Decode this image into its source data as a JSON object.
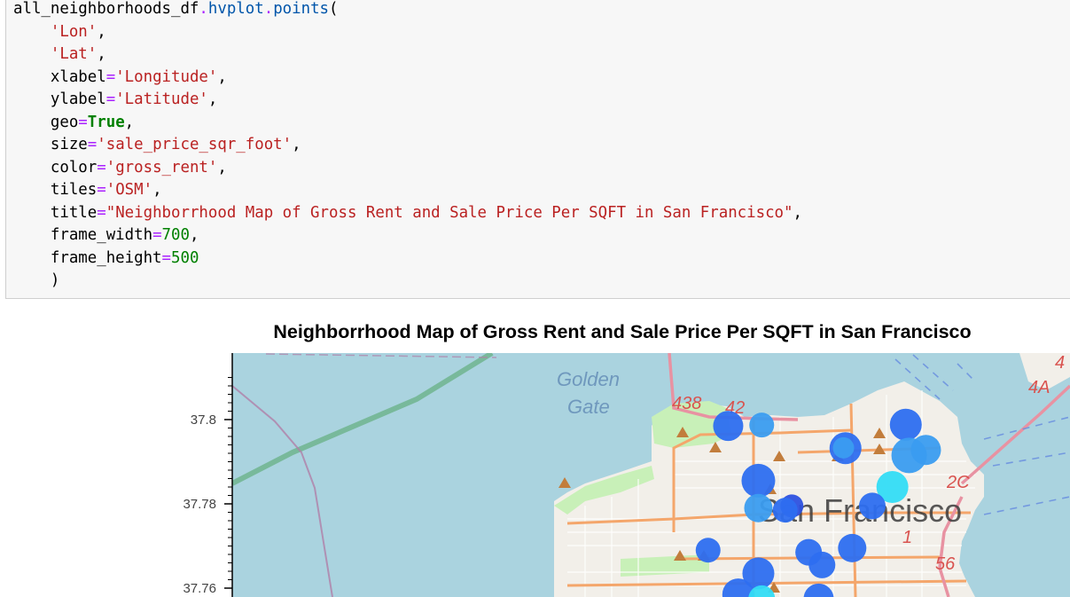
{
  "code_cell": {
    "lines": [
      [
        {
          "t": "all_neighborhoods_df",
          "c": "var"
        },
        {
          "t": ".",
          "c": "op"
        },
        {
          "t": "hvplot",
          "c": "attr"
        },
        {
          "t": ".",
          "c": "op"
        },
        {
          "t": "points",
          "c": "attr"
        },
        {
          "t": "(",
          "c": "var"
        }
      ],
      [
        {
          "t": "    ",
          "c": "var"
        },
        {
          "t": "'Lon'",
          "c": "str"
        },
        {
          "t": ",",
          "c": "var"
        }
      ],
      [
        {
          "t": "    ",
          "c": "var"
        },
        {
          "t": "'Lat'",
          "c": "str"
        },
        {
          "t": ",",
          "c": "var"
        }
      ],
      [
        {
          "t": "    xlabel",
          "c": "var"
        },
        {
          "t": "=",
          "c": "op"
        },
        {
          "t": "'Longitude'",
          "c": "str"
        },
        {
          "t": ",",
          "c": "var"
        }
      ],
      [
        {
          "t": "    ylabel",
          "c": "var"
        },
        {
          "t": "=",
          "c": "op"
        },
        {
          "t": "'Latitude'",
          "c": "str"
        },
        {
          "t": ",",
          "c": "var"
        }
      ],
      [
        {
          "t": "    geo",
          "c": "var"
        },
        {
          "t": "=",
          "c": "op"
        },
        {
          "t": "True",
          "c": "kw"
        },
        {
          "t": ",",
          "c": "var"
        }
      ],
      [
        {
          "t": "    size",
          "c": "var"
        },
        {
          "t": "=",
          "c": "op"
        },
        {
          "t": "'sale_price_sqr_foot'",
          "c": "str"
        },
        {
          "t": ",",
          "c": "var"
        }
      ],
      [
        {
          "t": "    color",
          "c": "var"
        },
        {
          "t": "=",
          "c": "op"
        },
        {
          "t": "'gross_rent'",
          "c": "str"
        },
        {
          "t": ",",
          "c": "var"
        }
      ],
      [
        {
          "t": "    tiles",
          "c": "var"
        },
        {
          "t": "=",
          "c": "op"
        },
        {
          "t": "'OSM'",
          "c": "str"
        },
        {
          "t": ",",
          "c": "var"
        }
      ],
      [
        {
          "t": "    title",
          "c": "var"
        },
        {
          "t": "=",
          "c": "op"
        },
        {
          "t": "\"Neighborrhood Map of Gross Rent and Sale Price Per SQFT in San Francisco\"",
          "c": "str"
        },
        {
          "t": ",",
          "c": "var"
        }
      ],
      [
        {
          "t": "    frame_width",
          "c": "var"
        },
        {
          "t": "=",
          "c": "op"
        },
        {
          "t": "700",
          "c": "num"
        },
        {
          "t": ",",
          "c": "var"
        }
      ],
      [
        {
          "t": "    frame_height",
          "c": "var"
        },
        {
          "t": "=",
          "c": "op"
        },
        {
          "t": "500",
          "c": "num"
        }
      ],
      [
        {
          "t": "    )",
          "c": "var"
        }
      ]
    ]
  },
  "plot": {
    "title": "Neighborrhood Map of Gross Rent and Sale Price Per SQFT in San Francisco",
    "y_ticks": [
      "37.8",
      "37.78",
      "37.76"
    ],
    "map_labels": {
      "golden": "Golden",
      "gate": "Gate",
      "city": "San Francisco",
      "route_438": "438",
      "route_42": "42",
      "route_4": "4",
      "route_4a": "4A",
      "route_2c": "2C",
      "route_56": "56",
      "route_1": "1"
    }
  },
  "colors": {
    "water": "#aad3df",
    "land": "#f2efe9",
    "park": "#c8f0b8",
    "major_road": "#f4a66b",
    "highway": "#e892a2",
    "point_blue": "#2d6ef0",
    "point_mid": "#3a9cf0",
    "point_cyan": "#33dcf5"
  },
  "chart_data": {
    "type": "scatter",
    "title": "Neighborrhood Map of Gross Rent and Sale Price Per SQFT in San Francisco",
    "ylabel": "",
    "xlabel": "",
    "y_ticks": [
      37.8,
      37.78,
      37.76
    ],
    "tiles": "OSM",
    "points": [
      {
        "lon": -122.446,
        "lat": 37.7985,
        "size": 34,
        "color": "#2d6ef0"
      },
      {
        "lon": -122.441,
        "lat": 37.7987,
        "size": 28,
        "color": "#3a9cf0"
      },
      {
        "lon": -122.4285,
        "lat": 37.7932,
        "size": 36,
        "color": "#2d6ef0"
      },
      {
        "lon": -122.4288,
        "lat": 37.7933,
        "size": 24,
        "color": "#3a9cf0"
      },
      {
        "lon": -122.4195,
        "lat": 37.7988,
        "size": 36,
        "color": "#2d6ef0"
      },
      {
        "lon": -122.419,
        "lat": 37.7915,
        "size": 40,
        "color": "#3a9cf0"
      },
      {
        "lon": -122.4165,
        "lat": 37.7928,
        "size": 34,
        "color": "#3a9cf0"
      },
      {
        "lon": -122.4215,
        "lat": 37.784,
        "size": 36,
        "color": "#33dcf5"
      },
      {
        "lon": -122.4415,
        "lat": 37.7855,
        "size": 38,
        "color": "#2d6ef0"
      },
      {
        "lon": -122.4415,
        "lat": 37.779,
        "size": 32,
        "color": "#3a9cf0"
      },
      {
        "lon": -122.4365,
        "lat": 37.7795,
        "size": 26,
        "color": "#2d51e0"
      },
      {
        "lon": -122.4375,
        "lat": 37.7785,
        "size": 28,
        "color": "#2d6ef0"
      },
      {
        "lon": -122.4245,
        "lat": 37.7795,
        "size": 30,
        "color": "#2d6ef0"
      },
      {
        "lon": -122.449,
        "lat": 37.769,
        "size": 28,
        "color": "#2d6ef0"
      },
      {
        "lon": -122.434,
        "lat": 37.7685,
        "size": 30,
        "color": "#2d6ef0"
      },
      {
        "lon": -122.432,
        "lat": 37.7655,
        "size": 30,
        "color": "#2d6ef0"
      },
      {
        "lon": -122.4275,
        "lat": 37.7695,
        "size": 32,
        "color": "#2d6ef0"
      },
      {
        "lon": -122.4415,
        "lat": 37.7635,
        "size": 36,
        "color": "#2d6ef0"
      },
      {
        "lon": -122.4445,
        "lat": 37.7585,
        "size": 36,
        "color": "#2d6ef0"
      },
      {
        "lon": -122.4325,
        "lat": 37.7575,
        "size": 34,
        "color": "#2d6ef0"
      },
      {
        "lon": -122.441,
        "lat": 37.7575,
        "size": 30,
        "color": "#33dcf5"
      }
    ]
  }
}
